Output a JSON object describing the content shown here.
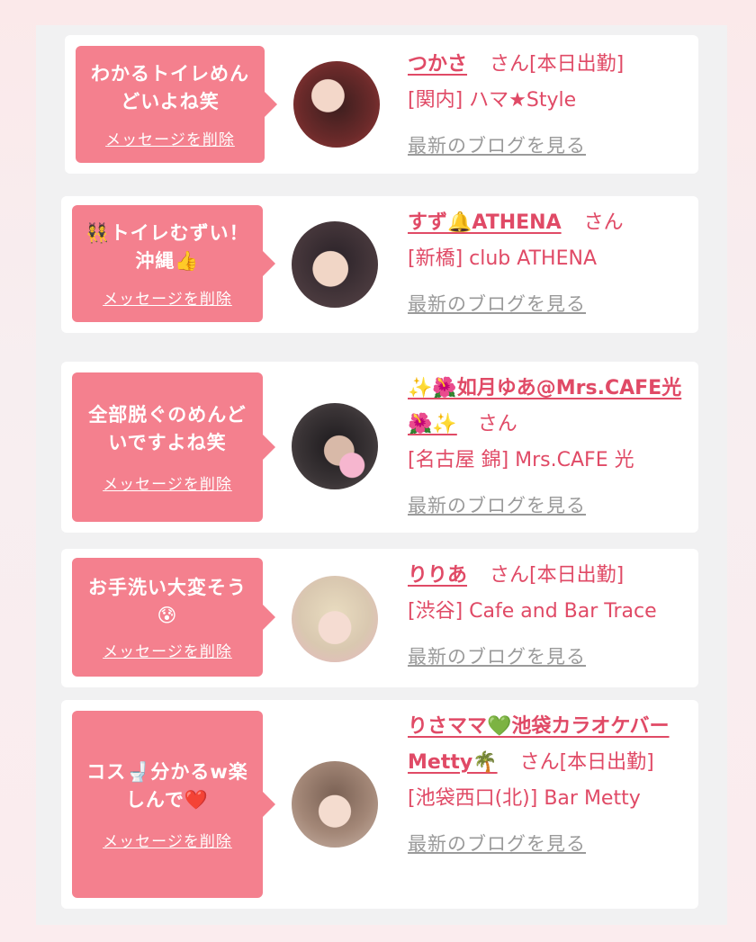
{
  "entries": [
    {
      "message": "わかるトイレめんどいよね笑",
      "delete_label": "メッセージを削除",
      "name": "つかさ",
      "suffix": "さん[本日出勤]",
      "shop": "[関内] ハマ★Style",
      "blog_label": "最新のブログを見る"
    },
    {
      "message": "👯トイレむずい！沖縄👍",
      "delete_label": "メッセージを削除",
      "name": "すず🔔ATHENA",
      "suffix": "さん",
      "shop": "[新橋] club ATHENA",
      "blog_label": "最新のブログを見る"
    },
    {
      "message": "全部脱ぐのめんどいですよね笑",
      "delete_label": "メッセージを削除",
      "name": "✨🌺如月ゆあ@Mrs.CAFE光🌺✨",
      "suffix": "さん",
      "shop": "[名古屋 錦] Mrs.CAFE 光",
      "blog_label": "最新のブログを見る"
    },
    {
      "message": "お手洗い大変そう😰",
      "delete_label": "メッセージを削除",
      "name": "りりあ",
      "suffix": "さん[本日出勤]",
      "shop": "[渋谷] Cafe and Bar Trace",
      "blog_label": "最新のブログを見る"
    },
    {
      "message": "コス🚽分かるw楽しんで❤️",
      "delete_label": "メッセージを削除",
      "name": "りさママ💚池袋カラオケバーMetty🌴",
      "suffix": "さん[本日出勤]",
      "shop": "[池袋西口(北)] Bar Metty",
      "blog_label": "最新のブログを見る"
    }
  ],
  "colors": {
    "accent": "#e04a66",
    "bubble": "#f4808e",
    "muted": "#9a9a9a"
  }
}
